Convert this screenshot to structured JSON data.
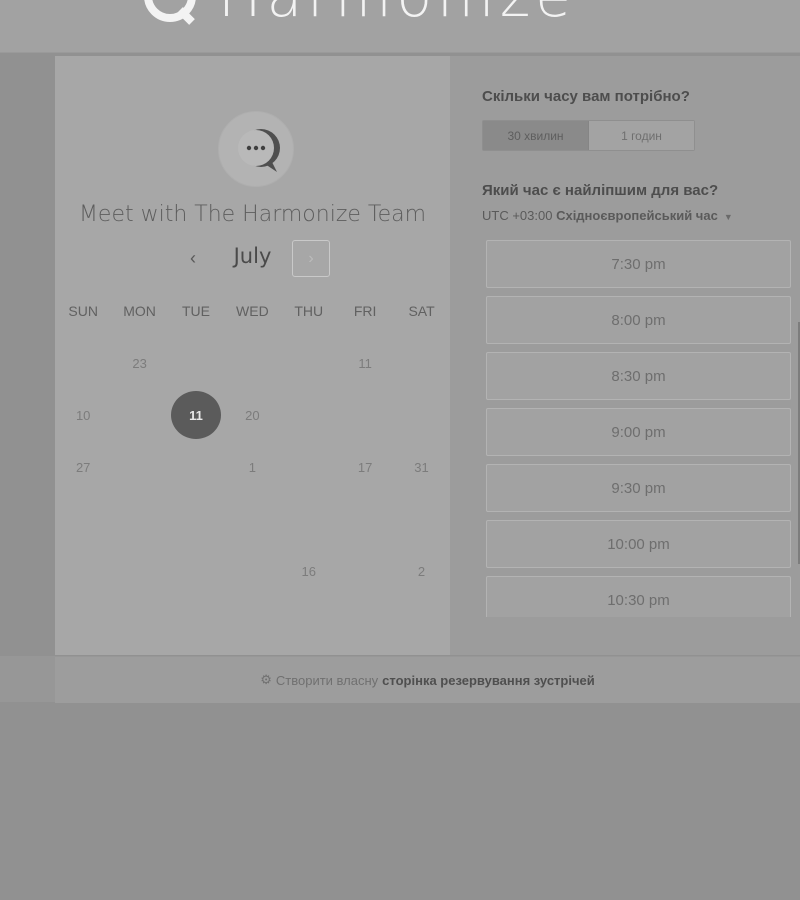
{
  "brand": {
    "name": "Harmonize"
  },
  "calendar": {
    "title": "Meet with The Harmonize Team",
    "month": "July",
    "prev_label": "‹",
    "next_label": "›",
    "weekdays": [
      "SUN",
      "MON",
      "TUE",
      "WED",
      "THU",
      "FRI",
      "SAT"
    ],
    "days": [
      [
        "",
        "23",
        "",
        "",
        "",
        "11",
        ""
      ],
      [
        "10",
        "",
        "11",
        "20",
        "",
        "",
        ""
      ],
      [
        "27",
        "",
        "",
        "1",
        "",
        "17",
        "31"
      ],
      [
        "",
        "",
        "",
        "",
        "",
        "",
        ""
      ],
      [
        "",
        "",
        "",
        "",
        "16",
        "",
        "2"
      ]
    ],
    "selected_day": "11"
  },
  "booking": {
    "duration_question": "Скільки часу вам потрібно?",
    "durations": [
      {
        "label": "30 хвилин",
        "active": true
      },
      {
        "label": "1 годин",
        "active": false
      }
    ],
    "time_question": "Який час є найліпшим для вас?",
    "timezone_offset": "UTC +03:00",
    "timezone_name": "Східноєвропейський час",
    "slots": [
      "7:30 pm",
      "8:00 pm",
      "8:30 pm",
      "9:00 pm",
      "9:30 pm",
      "10:00 pm",
      "10:30 pm"
    ]
  },
  "footer": {
    "prefix": "Створити власну",
    "bold": "сторінка резервування зустрічей"
  },
  "colors": {
    "background": "#919191",
    "panel_left": "#a7a7a7",
    "panel_right": "#9c9c9c",
    "selected_day": "#5b5b5b"
  }
}
